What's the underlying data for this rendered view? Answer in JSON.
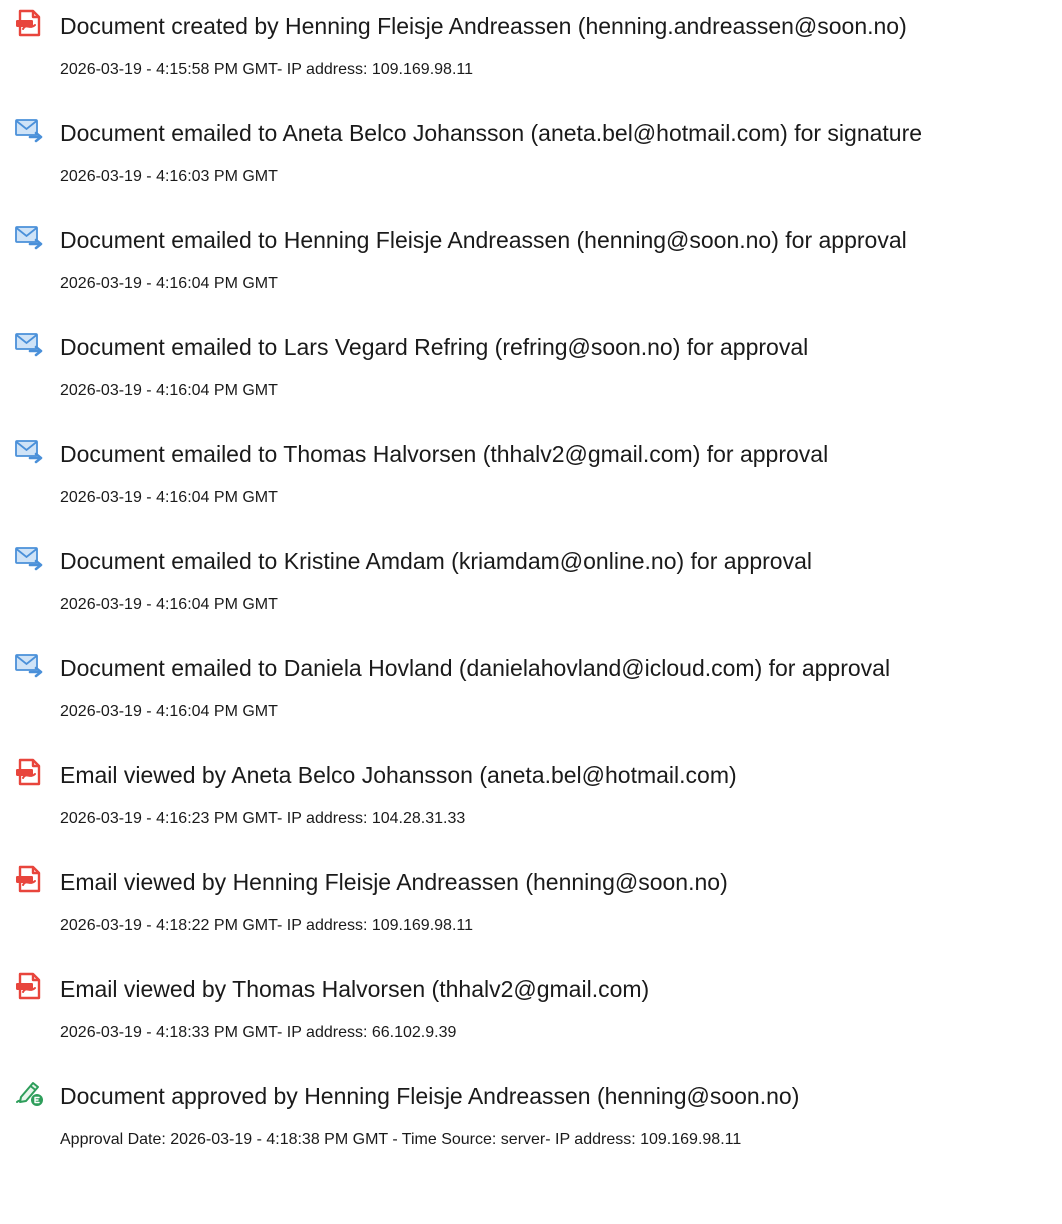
{
  "events": [
    {
      "icon": "document-created-icon",
      "title": "Document created by Henning Fleisje Andreassen (henning.andreassen@soon.no)",
      "meta": "2026-03-19 - 4:15:58 PM GMT- IP address: 109.169.98.11"
    },
    {
      "icon": "email-sent-icon",
      "title": "Document emailed to Aneta Belco Johansson (aneta.bel@hotmail.com) for signature",
      "meta": "2026-03-19 - 4:16:03 PM GMT"
    },
    {
      "icon": "email-sent-icon",
      "title": "Document emailed to Henning Fleisje Andreassen (henning@soon.no) for approval",
      "meta": "2026-03-19 - 4:16:04 PM GMT"
    },
    {
      "icon": "email-sent-icon",
      "title": "Document emailed to Lars Vegard Refring (refring@soon.no) for approval",
      "meta": "2026-03-19 - 4:16:04 PM GMT"
    },
    {
      "icon": "email-sent-icon",
      "title": "Document emailed to Thomas Halvorsen (thhalv2@gmail.com) for approval",
      "meta": "2026-03-19 - 4:16:04 PM GMT"
    },
    {
      "icon": "email-sent-icon",
      "title": "Document emailed to Kristine Amdam (kriamdam@online.no) for approval",
      "meta": "2026-03-19 - 4:16:04 PM GMT"
    },
    {
      "icon": "email-sent-icon",
      "title": "Document emailed to Daniela Hovland (danielahovland@icloud.com) for approval",
      "meta": "2026-03-19 - 4:16:04 PM GMT"
    },
    {
      "icon": "document-viewed-icon",
      "title": "Email viewed by Aneta Belco Johansson (aneta.bel@hotmail.com)",
      "meta": "2026-03-19 - 4:16:23 PM GMT- IP address: 104.28.31.33"
    },
    {
      "icon": "document-viewed-icon",
      "title": "Email viewed by Henning Fleisje Andreassen (henning@soon.no)",
      "meta": "2026-03-19 - 4:18:22 PM GMT- IP address: 109.169.98.11"
    },
    {
      "icon": "document-viewed-icon",
      "title": "Email viewed by Thomas Halvorsen (thhalv2@gmail.com)",
      "meta": "2026-03-19 - 4:18:33 PM GMT- IP address: 66.102.9.39"
    },
    {
      "icon": "approval-pen-icon",
      "title": "Document approved by Henning Fleisje Andreassen (henning@soon.no)",
      "meta": "Approval Date: 2026-03-19 - 4:18:38 PM GMT - Time Source: server- IP address: 109.169.98.11"
    }
  ],
  "colors": {
    "pdf_red": "#E8453C",
    "mail_blue": "#4A90D9",
    "mail_light": "#CFE3F7",
    "pen_green": "#2E9E5B",
    "text": "#1A1A1A"
  }
}
